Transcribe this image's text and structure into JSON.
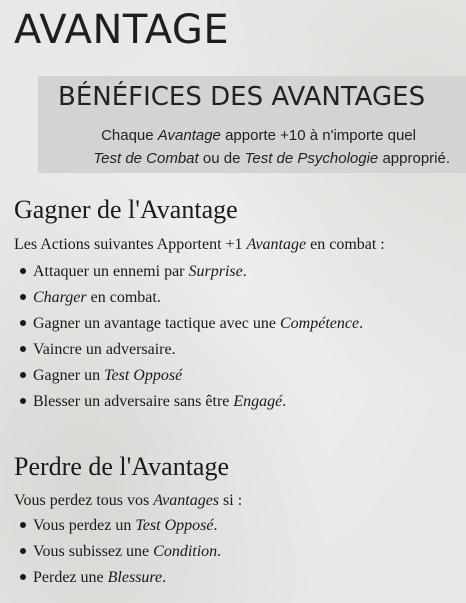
{
  "title": "AVANTAGE",
  "benefits": {
    "title": "BÉNÉFICES DES AVANTAGES",
    "line1": {
      "a": "Chaque ",
      "b": "Avantage",
      "c": " apporte +10 à n'importe quel"
    },
    "line2": {
      "a": "Test de Combat",
      "b": " ou de ",
      "c": "Test de Psychologie",
      "d": " approprié."
    }
  },
  "gain": {
    "title": "Gagner de l'Avantage",
    "intro": {
      "a": "Les Actions suivantes Apportent +1 ",
      "b": "Avantage",
      "c": " en combat :"
    },
    "items": [
      {
        "a": "Attaquer un ennemi par ",
        "b": "Surprise",
        "c": "."
      },
      {
        "a": "",
        "b": "Charger",
        "c": " en combat."
      },
      {
        "a": "Gagner un avantage tactique avec une ",
        "b": "Compétence",
        "c": "."
      },
      {
        "a": "Vaincre un adversaire.",
        "b": "",
        "c": ""
      },
      {
        "a": "Gagner un ",
        "b": "Test Opposé",
        "c": ""
      },
      {
        "a": "Blesser un adversaire sans être ",
        "b": "Engagé",
        "c": "."
      }
    ]
  },
  "lose": {
    "title": "Perdre de l'Avantage",
    "intro": {
      "a": "Vous perdez tous vos ",
      "b": "Avantages",
      "c": " si :"
    },
    "items": [
      {
        "a": "Vous perdez un ",
        "b": "Test Opposé",
        "c": "."
      },
      {
        "a": "Vous subissez une ",
        "b": "Condition",
        "c": "."
      },
      {
        "a": "Perdez une ",
        "b": "Blessure",
        "c": "."
      }
    ]
  }
}
